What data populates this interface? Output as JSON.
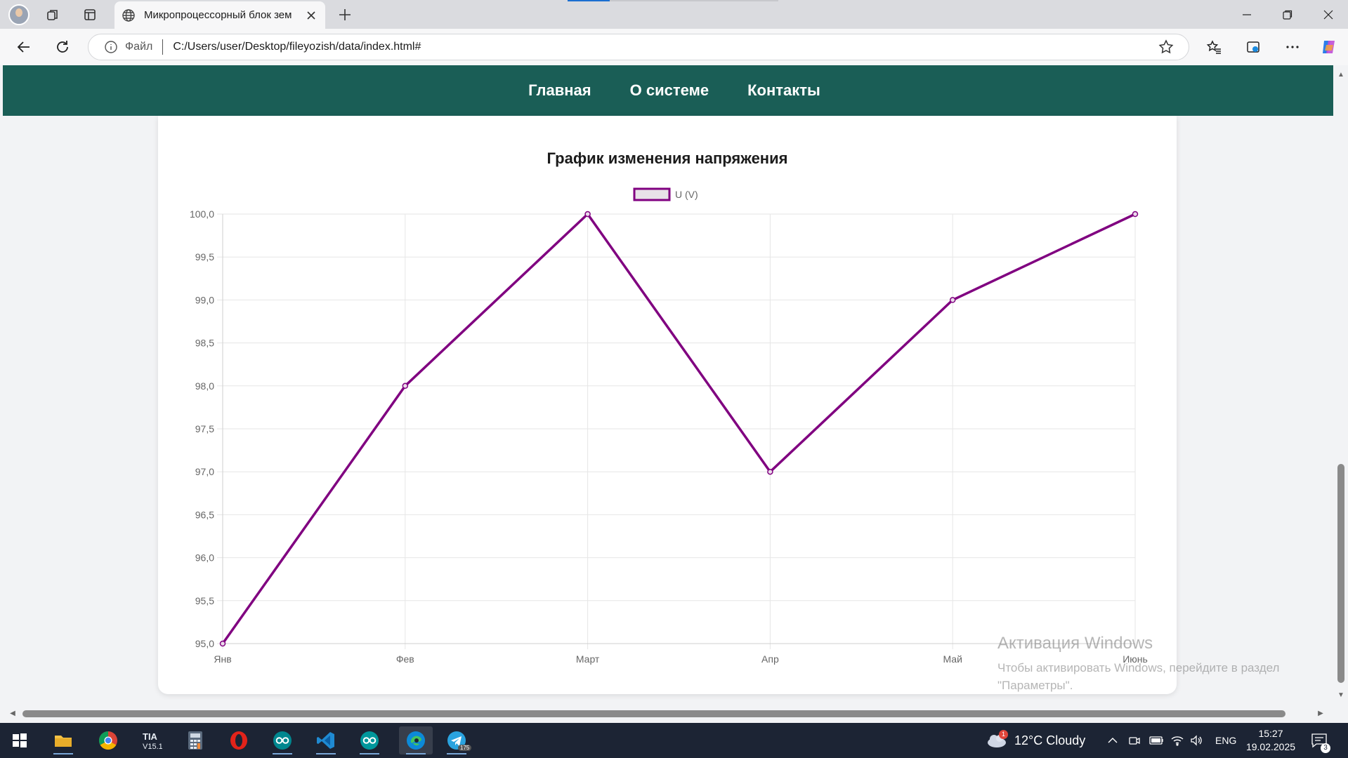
{
  "browser": {
    "tab_title": "Микропроцессорный блок зем",
    "address_label": "Файл",
    "url": "C:/Users/user/Desktop/fileyozish/data/index.html#"
  },
  "nav": {
    "items": [
      "Главная",
      "О системе",
      "Контакты"
    ]
  },
  "chart_data": {
    "type": "line",
    "title": "График изменения напряжения",
    "categories": [
      "Янв",
      "Фев",
      "Март",
      "Апр",
      "Май",
      "Июнь"
    ],
    "series": [
      {
        "name": "U (V)",
        "values": [
          95.0,
          98.0,
          100.0,
          97.0,
          99.0,
          100.0
        ],
        "color": "#800080"
      }
    ],
    "ylim": [
      95.0,
      100.0
    ],
    "yticks": [
      "95,0",
      "95,5",
      "96,0",
      "96,5",
      "97,0",
      "97,5",
      "98,0",
      "98,5",
      "99,0",
      "99,5",
      "100,0"
    ],
    "legend": "top-center",
    "grid": true
  },
  "watermark": {
    "title": "Активация Windows",
    "line1": "Чтобы активировать Windows, перейдите в раздел",
    "line2": "\"Параметры\"."
  },
  "taskbar": {
    "weather": "12°C  Cloudy",
    "weather_badge": "1",
    "language": "ENG",
    "time": "15:27",
    "date": "19.02.2025",
    "notifications": "3",
    "telegram_badge": "175"
  },
  "colors": {
    "header": "#1a5e56",
    "series": "#800080",
    "taskbar": "#1c2434"
  }
}
